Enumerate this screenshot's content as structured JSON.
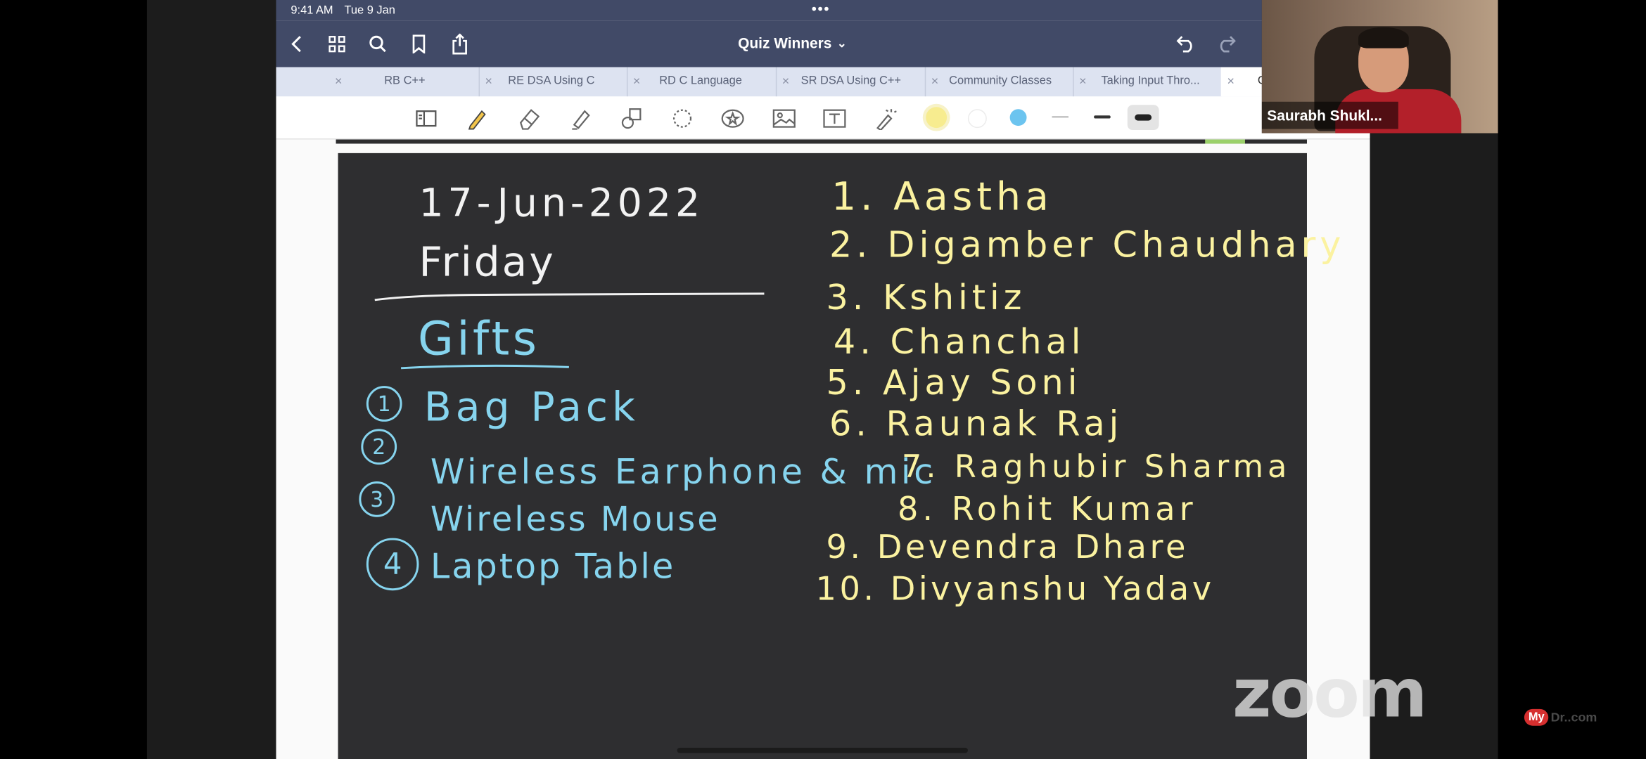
{
  "status_bar": {
    "time": "9:41 AM",
    "date": "Tue 9 Jan",
    "dots": "•••"
  },
  "nav": {
    "title": "Quiz Winners",
    "title_caret": "⌄"
  },
  "tabs": [
    {
      "label": "RB C++"
    },
    {
      "label": "RE DSA Using C"
    },
    {
      "label": "RD C Language"
    },
    {
      "label": "SR DSA Using C++"
    },
    {
      "label": "Community Classes"
    },
    {
      "label": "Taking Input Thro..."
    },
    {
      "label": "C"
    }
  ],
  "toolbar": {
    "colors": [
      "#f7ec8f",
      "#ffffff",
      "#6cc4ef"
    ]
  },
  "board": {
    "date": "17-Jun-2022",
    "day": "Friday",
    "gifts_heading": "Gifts",
    "gift_numbers": [
      "1",
      "2",
      "3",
      "4"
    ],
    "gifts": [
      "Bag Pack",
      "Wireless Earphone & mic",
      "Wireless Mouse",
      "Laptop Table"
    ],
    "winners": [
      "1. Aastha",
      "2. Digamber Chaudhary",
      "3. Kshitiz",
      "4. Chanchal",
      "5. Ajay Soni",
      "6. Raunak Raj",
      "7. Raghubir Sharma",
      "8. Rohit Kumar",
      "9. Devendra Dhare",
      "10. Divyanshu Yadav"
    ]
  },
  "speaker": {
    "name": "Saurabh Shukl..."
  },
  "zoom_logo": "zoom",
  "watermark": {
    "badge": "My",
    "rest": "Dr..com"
  }
}
